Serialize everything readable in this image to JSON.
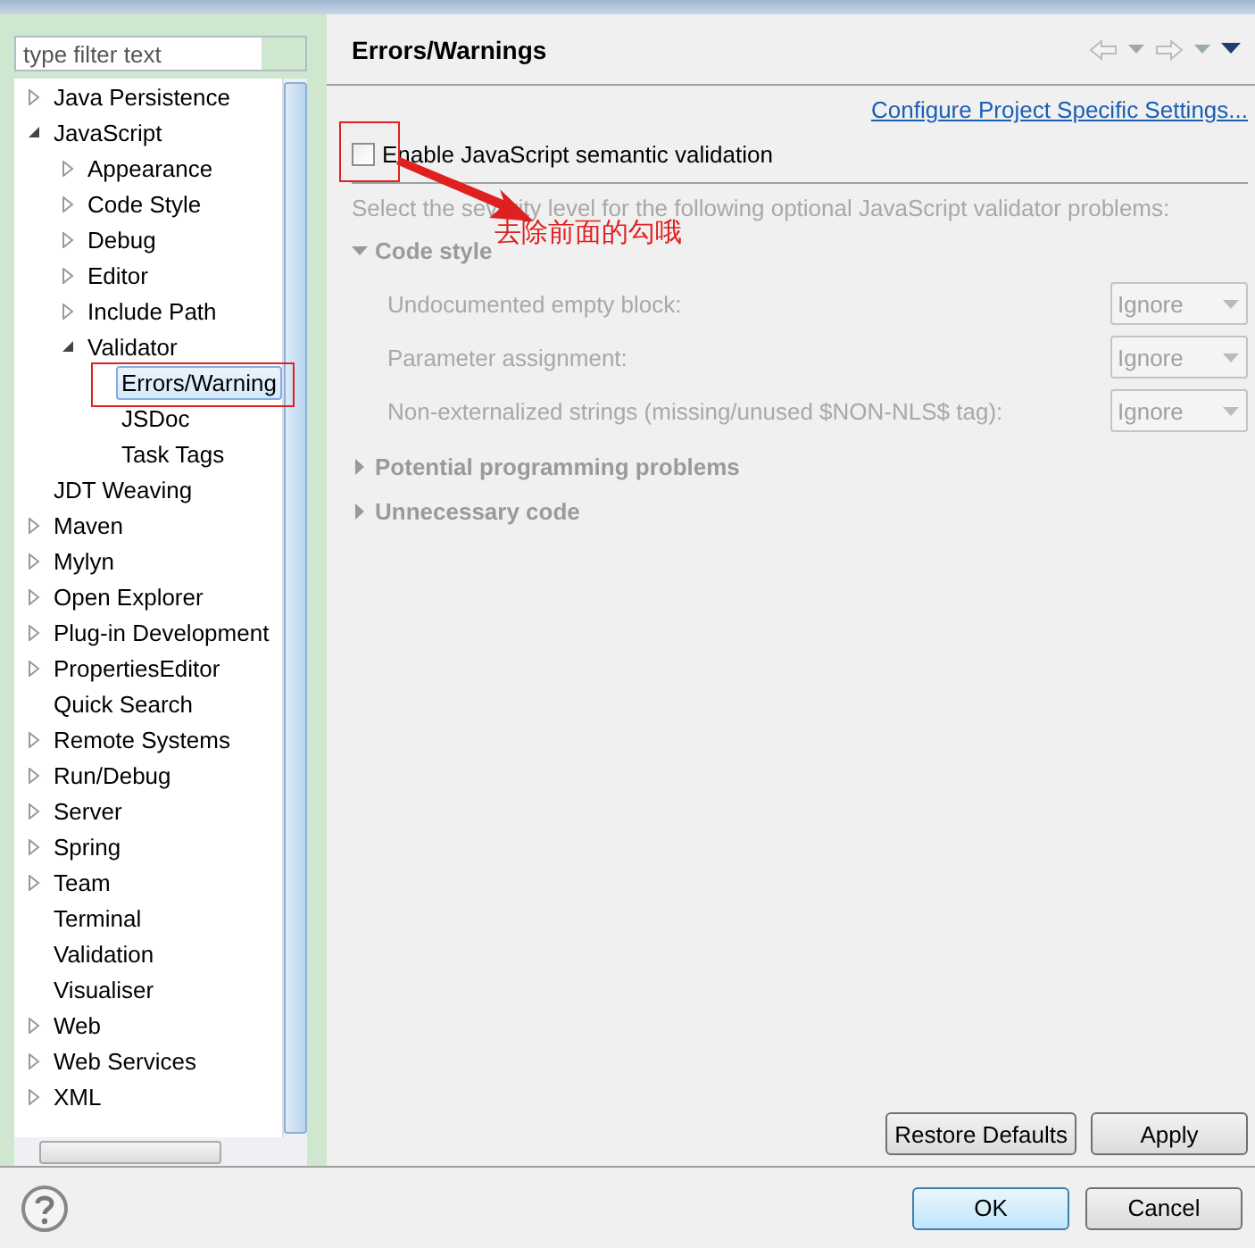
{
  "filter": {
    "placeholder": "type filter text"
  },
  "tree": [
    {
      "label": "Java Persistence",
      "kind": "branch",
      "expanded": false,
      "selected": false
    },
    {
      "label": "JavaScript",
      "kind": "branch",
      "expanded": true,
      "selected": false,
      "children": [
        {
          "label": "Appearance",
          "kind": "branch",
          "expanded": false,
          "selected": false
        },
        {
          "label": "Code Style",
          "kind": "branch",
          "expanded": false,
          "selected": false
        },
        {
          "label": "Debug",
          "kind": "branch",
          "expanded": false,
          "selected": false
        },
        {
          "label": "Editor",
          "kind": "branch",
          "expanded": false,
          "selected": false
        },
        {
          "label": "Include Path",
          "kind": "branch",
          "expanded": false,
          "selected": false
        },
        {
          "label": "Validator",
          "kind": "branch",
          "expanded": true,
          "selected": false,
          "children": [
            {
              "label": "Errors/Warning",
              "kind": "leaf",
              "selected": true
            },
            {
              "label": "JSDoc",
              "kind": "leaf",
              "selected": false
            },
            {
              "label": "Task Tags",
              "kind": "leaf",
              "selected": false
            }
          ]
        }
      ]
    },
    {
      "label": "JDT Weaving",
      "kind": "leaf",
      "selected": false
    },
    {
      "label": "Maven",
      "kind": "branch",
      "expanded": false,
      "selected": false
    },
    {
      "label": "Mylyn",
      "kind": "branch",
      "expanded": false,
      "selected": false
    },
    {
      "label": "Open Explorer",
      "kind": "branch",
      "expanded": false,
      "selected": false
    },
    {
      "label": "Plug-in Development",
      "kind": "branch",
      "expanded": false,
      "selected": false
    },
    {
      "label": "PropertiesEditor",
      "kind": "branch",
      "expanded": false,
      "selected": false
    },
    {
      "label": "Quick Search",
      "kind": "leaf",
      "selected": false
    },
    {
      "label": "Remote Systems",
      "kind": "branch",
      "expanded": false,
      "selected": false
    },
    {
      "label": "Run/Debug",
      "kind": "branch",
      "expanded": false,
      "selected": false
    },
    {
      "label": "Server",
      "kind": "branch",
      "expanded": false,
      "selected": false
    },
    {
      "label": "Spring",
      "kind": "branch",
      "expanded": false,
      "selected": false
    },
    {
      "label": "Team",
      "kind": "branch",
      "expanded": false,
      "selected": false
    },
    {
      "label": "Terminal",
      "kind": "leaf",
      "selected": false
    },
    {
      "label": "Validation",
      "kind": "leaf",
      "selected": false
    },
    {
      "label": "Visualiser",
      "kind": "leaf",
      "selected": false
    },
    {
      "label": "Web",
      "kind": "branch",
      "expanded": false,
      "selected": false
    },
    {
      "label": "Web Services",
      "kind": "branch",
      "expanded": false,
      "selected": false
    },
    {
      "label": "XML",
      "kind": "branch",
      "expanded": false,
      "selected": false
    }
  ],
  "page": {
    "title": "Errors/Warnings",
    "link": "Configure Project Specific Settings...",
    "enable": {
      "label": "Enable JavaScript semantic validation",
      "checked": false
    },
    "description": "Select the severity level for the following optional JavaScript validator problems:",
    "sections": [
      {
        "title": "Code style",
        "expanded": true,
        "options": [
          {
            "label": "Undocumented empty block:",
            "value": "Ignore"
          },
          {
            "label": "Parameter assignment:",
            "value": "Ignore"
          },
          {
            "label": "Non-externalized strings (missing/unused $NON-NLS$ tag):",
            "value": "Ignore"
          }
        ]
      },
      {
        "title": "Potential programming problems",
        "expanded": false
      },
      {
        "title": "Unnecessary code",
        "expanded": false
      }
    ],
    "buttons": [
      "Restore Defaults",
      "Apply"
    ]
  },
  "annotation": {
    "text": "去除前面的勾哦"
  },
  "footer": {
    "buttons": [
      {
        "label": "OK",
        "default": true
      },
      {
        "label": "Cancel",
        "default": false
      }
    ]
  }
}
